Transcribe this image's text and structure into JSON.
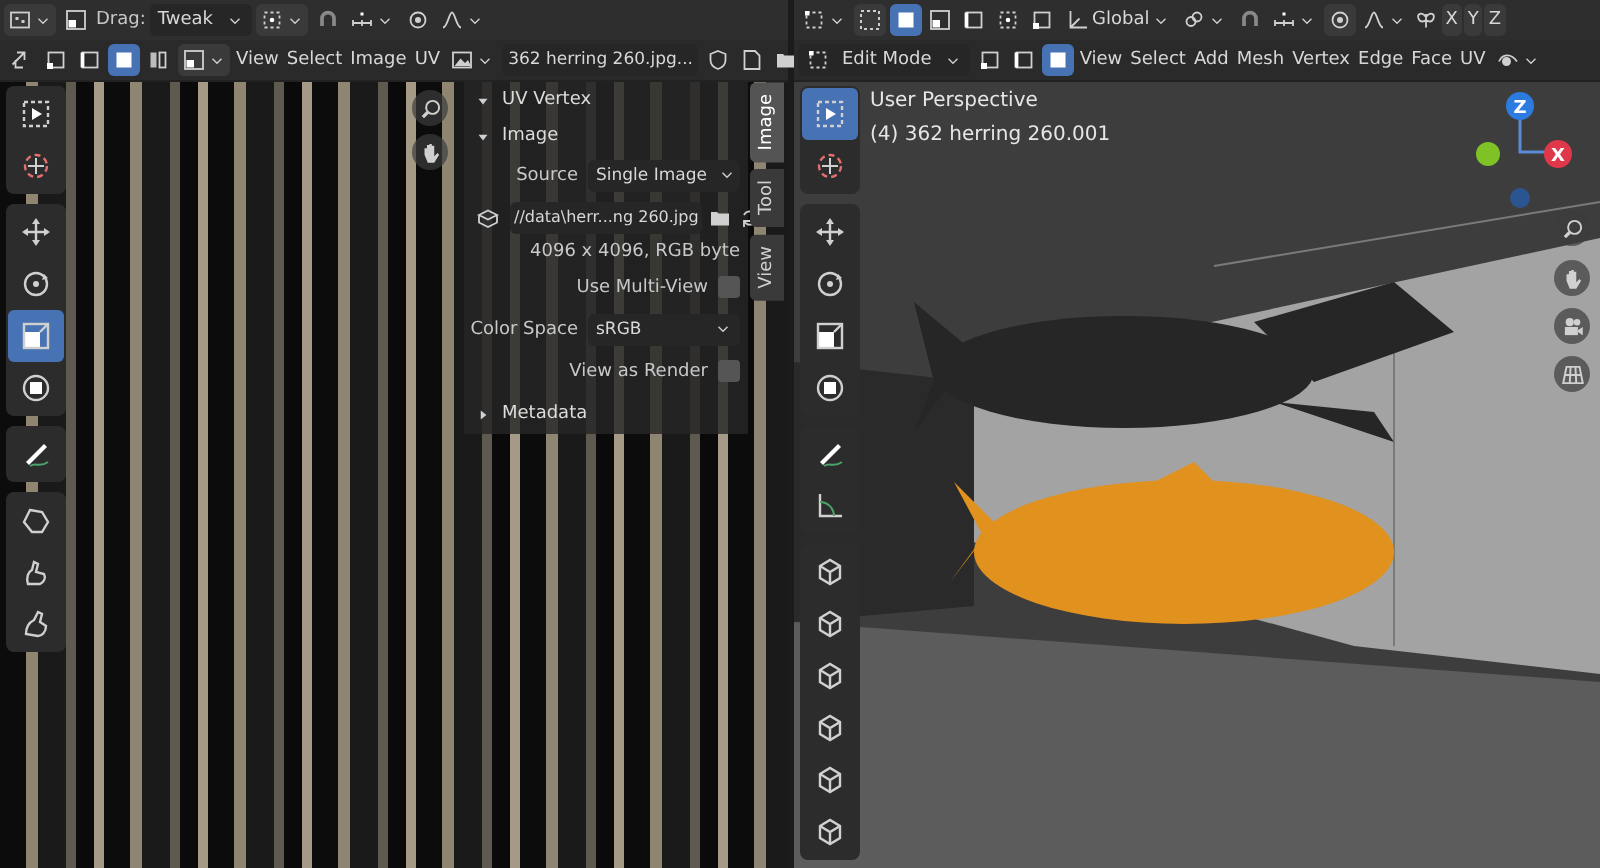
{
  "uv_editor": {
    "header": {
      "drag_label": "Drag:",
      "drag_mode": "Tweak",
      "select_modes": [
        {
          "selected": false
        },
        {
          "selected": false
        },
        {
          "selected": true
        },
        {
          "selected": false
        }
      ],
      "menus": [
        "View",
        "Select",
        "Image",
        "UV"
      ],
      "image_name": "362 herring 260.jpg..."
    },
    "tool_groups": [
      {
        "tools": [
          {
            "kind": "select",
            "selected": false
          },
          {
            "kind": "cursor",
            "selected": false
          }
        ]
      },
      {
        "tools": [
          {
            "kind": "move",
            "selected": false
          },
          {
            "kind": "rotate",
            "selected": false
          },
          {
            "kind": "scale",
            "selected": true
          },
          {
            "kind": "transform",
            "selected": false
          }
        ]
      },
      {
        "tools": [
          {
            "kind": "annotate",
            "selected": false
          }
        ]
      },
      {
        "tools": [
          {
            "kind": "grab",
            "selected": false
          },
          {
            "kind": "pinch",
            "selected": false
          },
          {
            "kind": "relax",
            "selected": false
          }
        ]
      }
    ],
    "sidebar": {
      "tabs": [
        {
          "label": "Image",
          "selected": true
        },
        {
          "label": "Tool",
          "selected": false
        },
        {
          "label": "View",
          "selected": false
        }
      ],
      "panels": [
        {
          "title": "UV Vertex",
          "expanded": true
        },
        {
          "title": "Image",
          "expanded": true,
          "fields": [
            {
              "kind": "dropdown",
              "label": "Source",
              "value": "Single Image"
            },
            {
              "kind": "filepath",
              "value": "//data\\herr...ng 260.jpg"
            },
            {
              "kind": "info",
              "value": "4096 x 4096, RGB byte"
            },
            {
              "kind": "checkbox",
              "label": "Use Multi-View",
              "checked": false
            },
            {
              "kind": "dropdown",
              "label": "Color Space",
              "value": "sRGB"
            },
            {
              "kind": "checkbox",
              "label": "View as Render",
              "checked": false
            }
          ]
        },
        {
          "title": "Metadata",
          "expanded": false
        }
      ]
    }
  },
  "viewport_3d": {
    "header": {
      "select_box_modes": [
        {
          "selected": true
        },
        {
          "selected": false
        },
        {
          "selected": false
        },
        {
          "selected": false
        },
        {
          "selected": false
        }
      ],
      "orientation": "Global",
      "mirror_axes": [
        "X",
        "Y",
        "Z"
      ],
      "mode": "Edit Mode",
      "mesh_select_modes": [
        {
          "selected": false
        },
        {
          "selected": false
        },
        {
          "selected": true
        }
      ],
      "menus": [
        "View",
        "Select",
        "Add",
        "Mesh",
        "Vertex",
        "Edge",
        "Face",
        "UV"
      ]
    },
    "overlay_text": [
      "User Perspective",
      "(4) 362 herring 260.001"
    ],
    "gizmo_labels": [
      "Z",
      "X"
    ],
    "tool_groups": [
      {
        "tools": [
          {
            "kind": "select",
            "selected": true
          },
          {
            "kind": "cursor",
            "selected": false
          }
        ]
      },
      {
        "tools": [
          {
            "kind": "move",
            "selected": false
          },
          {
            "kind": "rotate",
            "selected": false
          },
          {
            "kind": "scale",
            "selected": false
          },
          {
            "kind": "transform",
            "selected": false
          }
        ]
      },
      {
        "tools": [
          {
            "kind": "annotate",
            "selected": false
          },
          {
            "kind": "measure",
            "selected": false
          }
        ]
      },
      {
        "tools": [
          {
            "kind": "cube",
            "selected": false
          },
          {
            "kind": "cube",
            "selected": false
          },
          {
            "kind": "cube",
            "selected": false
          },
          {
            "kind": "cube",
            "selected": false
          },
          {
            "kind": "cube",
            "selected": false
          },
          {
            "kind": "cube",
            "selected": false
          }
        ]
      }
    ]
  }
}
